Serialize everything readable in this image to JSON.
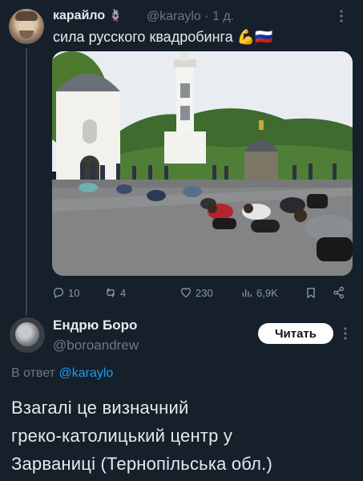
{
  "tweet1": {
    "author_name": "карайло",
    "author_emoji": "🪢",
    "handle": "@karaylo",
    "separator": "·",
    "time": "1 д.",
    "text": "сила русского квадробинга",
    "text_emojis": "💪🇷🇺",
    "actions": {
      "replies": "10",
      "retweets": "4",
      "likes": "230",
      "views": "6,9K"
    }
  },
  "reply": {
    "author_name": "Ендрю Боро",
    "handle": "@boroandrew",
    "follow_label": "Читать",
    "reply_prefix": "В ответ",
    "reply_mention": "@karaylo",
    "lines": [
      "Взагалі це визначний",
      "греко-католицький центр у",
      "Зарваниці (Тернопільська обл.)"
    ]
  },
  "colors": {
    "background": "#15202b",
    "accent": "#1d9bf0",
    "muted": "#71767b",
    "text": "#e7e9ea"
  },
  "icons": [
    "reply-icon",
    "retweet-icon",
    "like-icon",
    "views-icon",
    "bookmark-icon",
    "share-icon",
    "more-icon"
  ]
}
